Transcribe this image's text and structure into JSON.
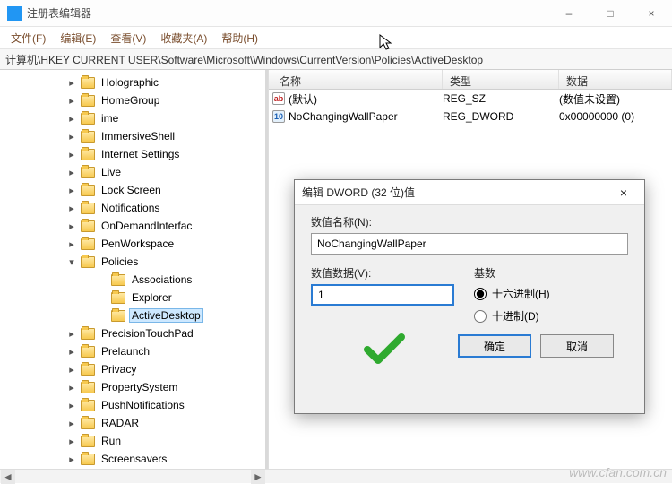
{
  "window": {
    "title": "注册表编辑器",
    "controls": {
      "minimize": "–",
      "maximize": "□",
      "close": "×"
    }
  },
  "menu": {
    "file": "文件(F)",
    "edit": "编辑(E)",
    "view": "查看(V)",
    "favorites": "收藏夹(A)",
    "help": "帮助(H)"
  },
  "path": "计算机\\HKEY CURRENT USER\\Software\\Microsoft\\Windows\\CurrentVersion\\Policies\\ActiveDesktop",
  "tree": {
    "nodes": [
      {
        "label": "Holographic",
        "expander": ">",
        "depth": 2
      },
      {
        "label": "HomeGroup",
        "expander": ">",
        "depth": 2
      },
      {
        "label": "ime",
        "expander": ">",
        "depth": 2
      },
      {
        "label": "ImmersiveShell",
        "expander": ">",
        "depth": 2
      },
      {
        "label": "Internet Settings",
        "expander": ">",
        "depth": 2
      },
      {
        "label": "Live",
        "expander": ">",
        "depth": 2
      },
      {
        "label": "Lock Screen",
        "expander": ">",
        "depth": 2
      },
      {
        "label": "Notifications",
        "expander": ">",
        "depth": 2
      },
      {
        "label": "OnDemandInterfac",
        "expander": ">",
        "depth": 2
      },
      {
        "label": "PenWorkspace",
        "expander": ">",
        "depth": 2
      },
      {
        "label": "Policies",
        "expander": "v",
        "depth": 2,
        "expanded": true
      },
      {
        "label": "Associations",
        "expander": "",
        "depth": 3
      },
      {
        "label": "Explorer",
        "expander": "",
        "depth": 3
      },
      {
        "label": "ActiveDesktop",
        "expander": "",
        "depth": 3,
        "selected": true
      },
      {
        "label": "PrecisionTouchPad",
        "expander": ">",
        "depth": 2
      },
      {
        "label": "Prelaunch",
        "expander": ">",
        "depth": 2
      },
      {
        "label": "Privacy",
        "expander": ">",
        "depth": 2
      },
      {
        "label": "PropertySystem",
        "expander": ">",
        "depth": 2
      },
      {
        "label": "PushNotifications",
        "expander": ">",
        "depth": 2
      },
      {
        "label": "RADAR",
        "expander": ">",
        "depth": 2
      },
      {
        "label": "Run",
        "expander": ">",
        "depth": 2
      },
      {
        "label": "Screensavers",
        "expander": ">",
        "depth": 2
      }
    ]
  },
  "list": {
    "columns": {
      "name": "名称",
      "type": "类型",
      "data": "数据"
    },
    "rows": [
      {
        "icon": "sz",
        "name": "(默认)",
        "type": "REG_SZ",
        "data": "(数值未设置)"
      },
      {
        "icon": "dw",
        "name": "NoChangingWallPaper",
        "type": "REG_DWORD",
        "data": "0x00000000 (0)"
      }
    ]
  },
  "dialog": {
    "title": "编辑 DWORD (32 位)值",
    "name_label": "数值名称(N):",
    "name_value": "NoChangingWallPaper",
    "data_label": "数值数据(V):",
    "data_value": "1",
    "base_label": "基数",
    "radio_hex": "十六进制(H)",
    "radio_dec": "十进制(D)",
    "ok": "确定",
    "cancel": "取消",
    "close": "×"
  },
  "watermark": "www.cfan.com.cn"
}
